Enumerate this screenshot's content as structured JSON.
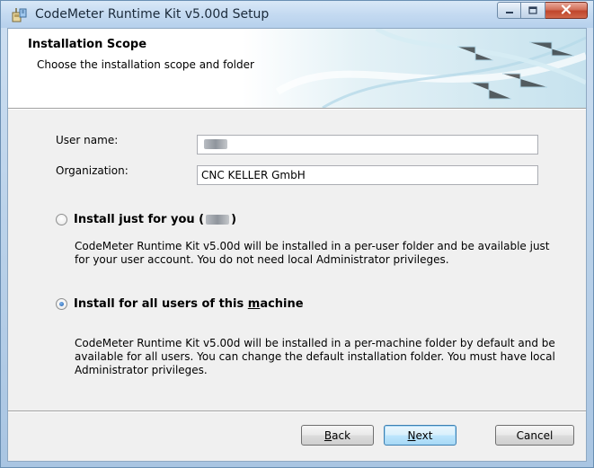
{
  "window": {
    "title": "CodeMeter Runtime Kit v5.00d Setup",
    "title_color": "#1b2a3a",
    "accent": "#3c7fb1"
  },
  "banner": {
    "title": "Installation Scope",
    "subtitle": "Choose the installation scope and folder"
  },
  "form": {
    "user_name_label": "User name:",
    "user_name_value": "",
    "organization_label": "Organization:",
    "organization_value": "CNC KELLER GmbH"
  },
  "options": [
    {
      "label_prefix": "Install just for you (",
      "label_suffix": ")",
      "selected": false,
      "description": "CodeMeter Runtime Kit v5.00d will be installed in a per-user folder and be available just for your user account. You do not need local Administrator privileges."
    },
    {
      "label_before_mnemonic": "Install for all users of this ",
      "label_mnemonic": "m",
      "label_after_mnemonic": "achine",
      "selected": true,
      "description": "CodeMeter Runtime Kit v5.00d will be installed in a per-machine folder by default and be available for all users. You can change the default installation folder. You must have local Administrator privileges."
    }
  ],
  "buttons": {
    "back_first": "B",
    "back_rest": "ack",
    "next_first": "N",
    "next_rest": "ext",
    "cancel": "Cancel"
  },
  "icons": {
    "app": "installer-icon",
    "minimize": "minimize-icon",
    "maximize": "maximize-icon",
    "close": "close-icon"
  }
}
